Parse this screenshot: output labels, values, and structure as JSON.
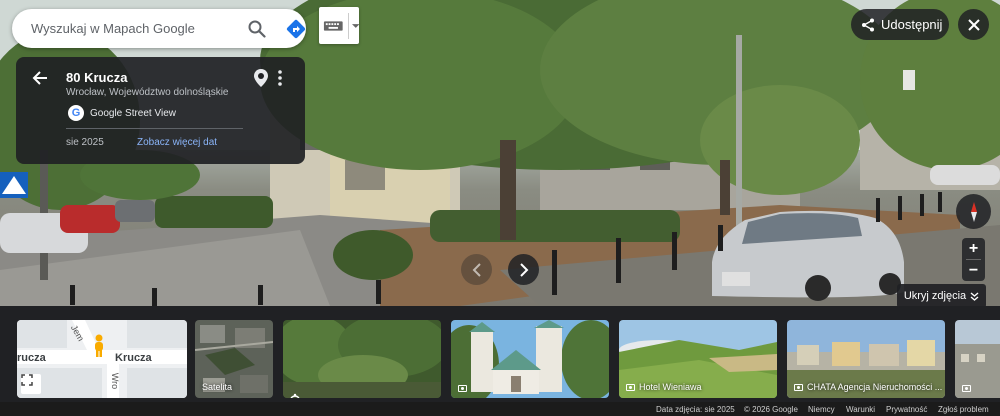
{
  "search": {
    "placeholder": "Wyszukaj w Mapach Google"
  },
  "icons": {
    "search": "search-icon",
    "directions": "directions-icon",
    "keyboard": "keyboard-icon",
    "back": "arrow-back-icon",
    "pin": "location-pin-icon",
    "more": "more-vert-icon",
    "share": "share-icon",
    "close": "close-icon",
    "compass": "compass-icon",
    "camera": "camera-icon",
    "fullscreen": "fullscreen-icon"
  },
  "card": {
    "title": "80 Krucza",
    "subtitle": "Wrocław, Województwo dolnośląskie",
    "source": "Google Street View",
    "date": "sie 2025",
    "more_dates": "Zobacz więcej dat"
  },
  "share": {
    "label": "Udostępnij"
  },
  "zoom": {
    "in": "+",
    "out": "−"
  },
  "hide_photos": {
    "label": "Ukryj zdjęcia"
  },
  "map_thumb": {
    "street_main": "Krucza",
    "street_side": "Jem",
    "street_left": "rucza",
    "street_right": "Wro"
  },
  "thumbs": [
    {
      "label": "Satelita"
    },
    {
      "label": ""
    },
    {
      "label": ""
    },
    {
      "label": "Hotel Wieniawa"
    },
    {
      "label": "CHATA Agencja Nieruchomości ..."
    },
    {
      "label": ""
    }
  ],
  "footer": {
    "date": "Data zdjęcia: sie 2025",
    "copyright": "© 2026 Google",
    "country": "Niemcy",
    "terms": "Warunki",
    "privacy": "Prywatność",
    "report": "Zgłoś problem"
  },
  "colors": {
    "panel": "#202124",
    "link": "#8ab4f8",
    "directions": "#1a73e8",
    "compass_north": "#d93025"
  }
}
